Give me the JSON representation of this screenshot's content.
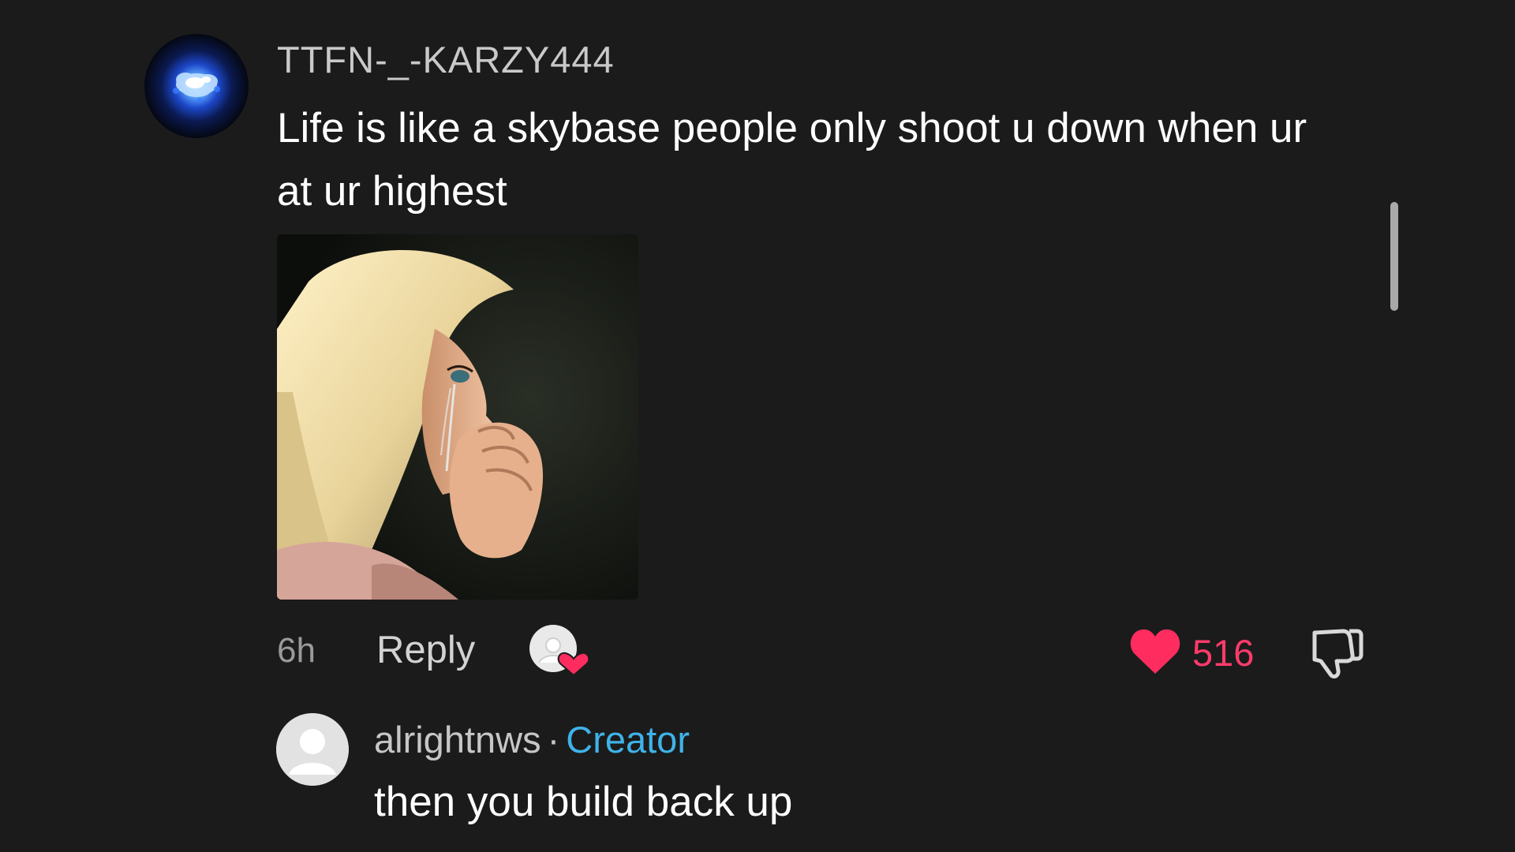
{
  "comment": {
    "username": "TTFN-_-KARZY444",
    "text": "Life is like a skybase people only shoot u down when ur at ur highest",
    "avatar_icon": "blue-flower-avatar",
    "image_icon": "crying-doll-image",
    "time": "6h",
    "reply_label": "Reply",
    "creator_liked_icon": "creator-liked-heart-icon",
    "like_count": "516",
    "like_icon": "heart-icon",
    "dislike_icon": "thumbs-down-icon",
    "accent_color": "#ff3b6b"
  },
  "reply": {
    "username": "alrightnws",
    "separator": "·",
    "badge": "Creator",
    "badge_color": "#3fb3e8",
    "text": "then you build back up",
    "avatar_icon": "default-user-avatar"
  }
}
